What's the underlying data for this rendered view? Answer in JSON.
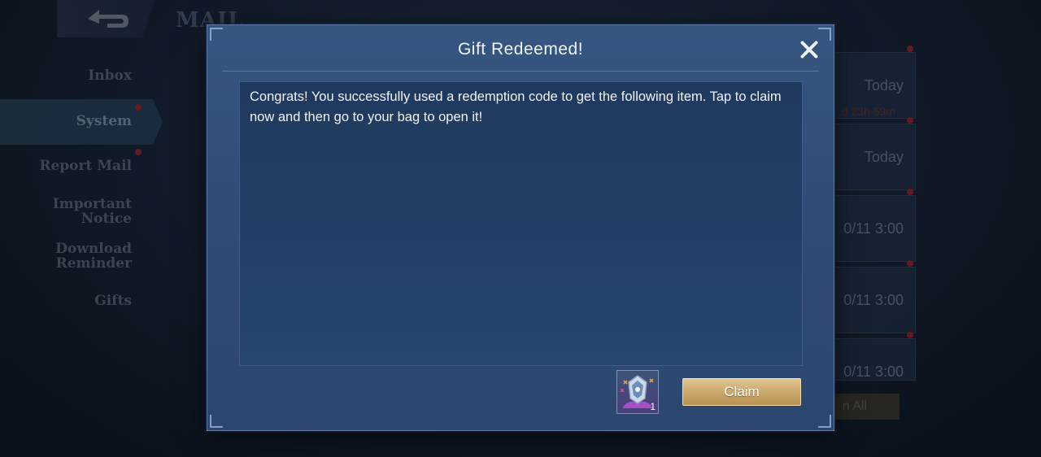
{
  "background": {
    "header_title": "MAIL",
    "nav": [
      "Inbox",
      "System",
      "Report Mail",
      "Important Notice",
      "Download Reminder",
      "Gifts"
    ],
    "active_nav": "System",
    "mail_dates": [
      "Today",
      "Today",
      "0/11 3:00",
      "0/11 3:00",
      "0/11 3:00"
    ],
    "countdown": "d 23h 59m",
    "claim_all_label": "n All"
  },
  "modal": {
    "title": "Gift Redeemed!",
    "message": "Congrats! You successfully used a redemption code to get the following item. Tap to claim now and then go to your bag to open it!",
    "item": {
      "icon": "skin-box-icon",
      "quantity": "1"
    },
    "claim_label": "Claim"
  },
  "colors": {
    "accent_gold": "#c9a56a",
    "modal_blue": "#365681",
    "alert_red": "#b5252a"
  }
}
